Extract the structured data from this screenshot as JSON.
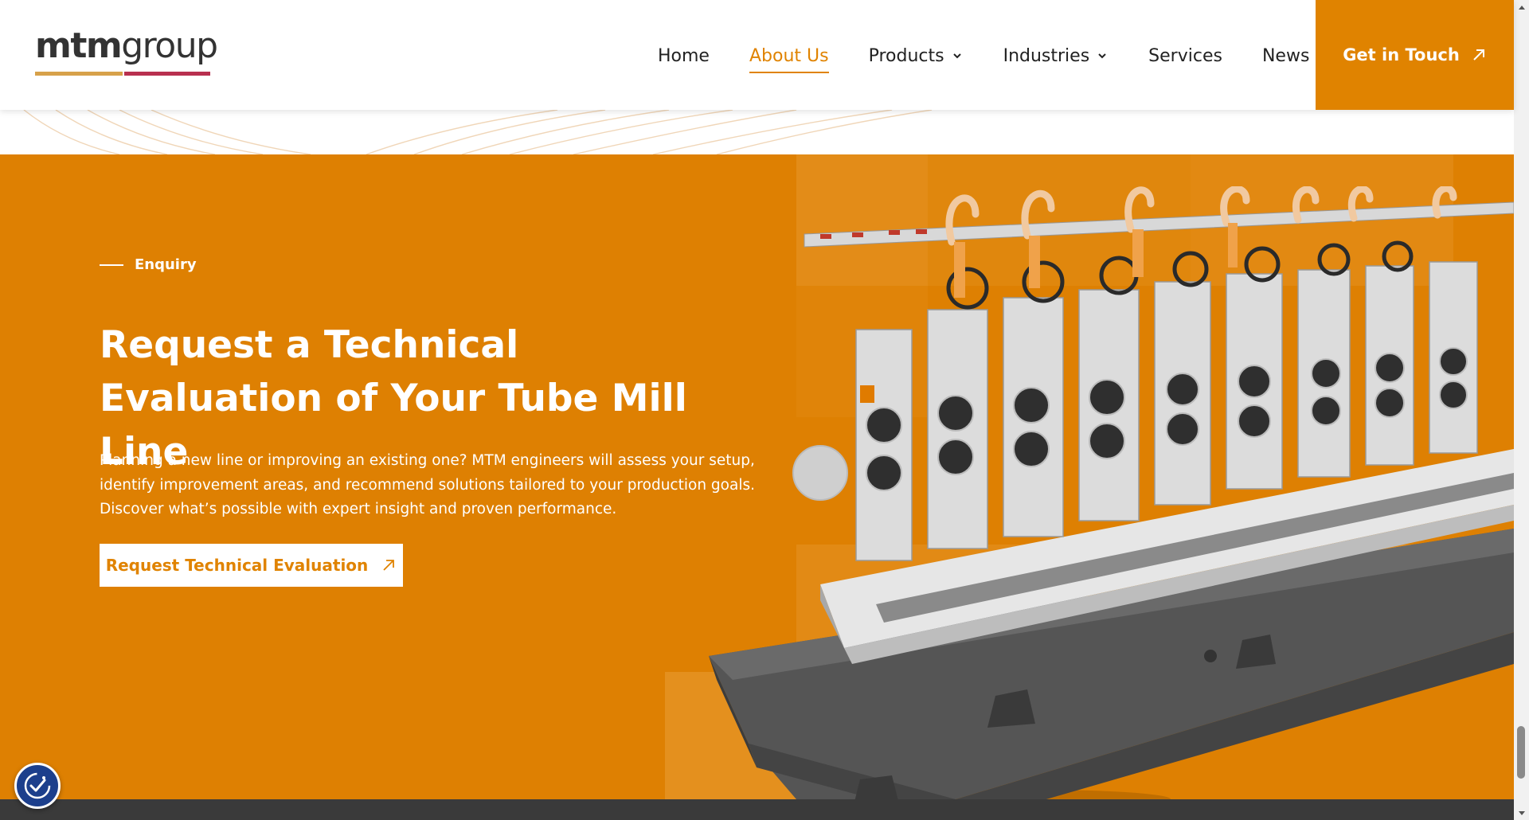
{
  "colors": {
    "accent": "#e08300",
    "hero_bg": "#de8002",
    "logo_bar_gold": "#d7a14a",
    "logo_bar_red": "#b8304f",
    "footer_dark": "#3a3a3a",
    "a11y_blue": "#1c3f8c"
  },
  "logo": {
    "part1": "mtm",
    "part2": "group"
  },
  "nav": {
    "items": [
      {
        "label": "Home",
        "active": false,
        "dropdown": false
      },
      {
        "label": "About Us",
        "active": true,
        "dropdown": false
      },
      {
        "label": "Products",
        "active": false,
        "dropdown": true
      },
      {
        "label": "Industries",
        "active": false,
        "dropdown": true
      },
      {
        "label": "Services",
        "active": false,
        "dropdown": false
      },
      {
        "label": "News",
        "active": false,
        "dropdown": false
      }
    ],
    "cta_label": "Get in Touch",
    "cta_icon": "arrow-up-right-icon"
  },
  "hero": {
    "eyebrow": "Enquiry",
    "title": "Request a Technical Evaluation of Your Tube Mill Line",
    "description": "Planning a new line or improving an existing one? MTM engineers will assess your setup, identify improvement areas, and recommend solutions tailored to your production goals. Discover what’s possible with expert insight and proven performance.",
    "button_label": "Request Technical Evaluation",
    "button_icon": "arrow-up-right-icon",
    "image": "tube-mill-machine-image"
  },
  "accessibility": {
    "icon": "accessibility-icon"
  },
  "scrollbar": {
    "up_icon": "scroll-up-arrow-icon",
    "down_icon": "scroll-down-arrow-icon"
  }
}
